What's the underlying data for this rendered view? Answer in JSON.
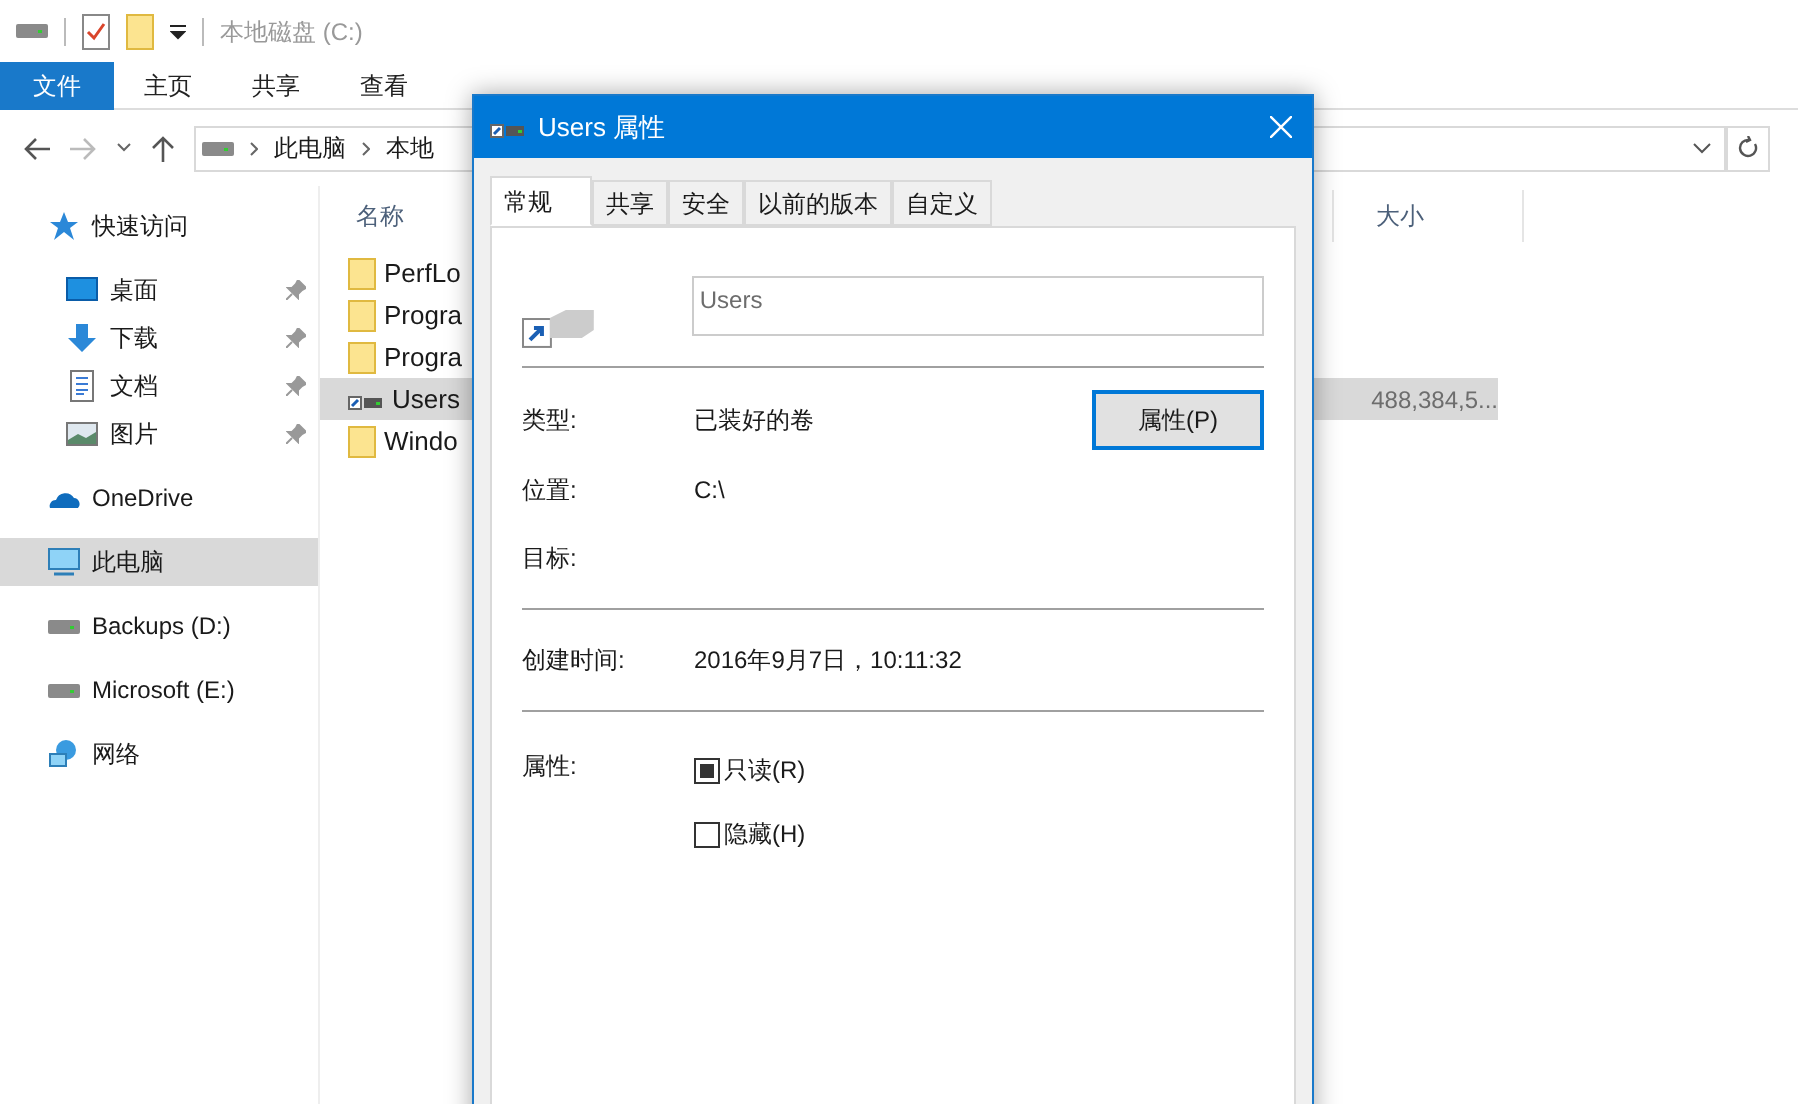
{
  "window": {
    "title": "本地磁盘 (C:)"
  },
  "ribbon_tabs": [
    {
      "label": "文件",
      "selected": true
    },
    {
      "label": "主页",
      "selected": false
    },
    {
      "label": "共享",
      "selected": false
    },
    {
      "label": "查看",
      "selected": false
    }
  ],
  "address": {
    "crumbs": [
      "此电脑",
      "本地"
    ]
  },
  "sidebar": {
    "items": [
      {
        "label": "快速访问",
        "kind": "star",
        "pinned": false,
        "selected": false
      },
      {
        "label": "桌面",
        "kind": "desktop",
        "pinned": true,
        "selected": false
      },
      {
        "label": "下载",
        "kind": "download",
        "pinned": true,
        "selected": false
      },
      {
        "label": "文档",
        "kind": "document",
        "pinned": true,
        "selected": false
      },
      {
        "label": "图片",
        "kind": "pictures",
        "pinned": true,
        "selected": false
      },
      {
        "label": "OneDrive",
        "kind": "cloud",
        "pinned": false,
        "selected": false
      },
      {
        "label": "此电脑",
        "kind": "pc",
        "pinned": false,
        "selected": true
      },
      {
        "label": "Backups (D:)",
        "kind": "drive",
        "pinned": false,
        "selected": false
      },
      {
        "label": "Microsoft (E:)",
        "kind": "drive",
        "pinned": false,
        "selected": false
      },
      {
        "label": "网络",
        "kind": "network",
        "pinned": false,
        "selected": false
      }
    ]
  },
  "file_list": {
    "columns": [
      "名称",
      "大小"
    ],
    "rows": [
      {
        "name": "PerfLo",
        "kind": "folder",
        "selected": false
      },
      {
        "name": "Progra",
        "kind": "folder",
        "selected": false
      },
      {
        "name": "Progra",
        "kind": "folder",
        "selected": false
      },
      {
        "name": "Users",
        "kind": "link",
        "selected": true,
        "size": "488,384,5..."
      },
      {
        "name": "Windo",
        "kind": "folder",
        "selected": false
      }
    ]
  },
  "dialog": {
    "title": "Users 属性",
    "tabs": [
      {
        "label": "常规",
        "selected": true
      },
      {
        "label": "共享",
        "selected": false
      },
      {
        "label": "安全",
        "selected": false
      },
      {
        "label": "以前的版本",
        "selected": false
      },
      {
        "label": "自定义",
        "selected": false
      }
    ],
    "name_field": {
      "value": "Users"
    },
    "type_label": "类型:",
    "type_value": "已装好的卷",
    "properties_button": "属性(P)",
    "location_label": "位置:",
    "location_value": "C:\\",
    "target_label": "目标:",
    "created_label": "创建时间:",
    "created_value": "2016年9月7日，10:11:32",
    "attributes_label": "属性:",
    "attributes": [
      {
        "label": "只读(R)",
        "indeterminate": true
      },
      {
        "label": "隐藏(H)",
        "indeterminate": false
      }
    ]
  }
}
